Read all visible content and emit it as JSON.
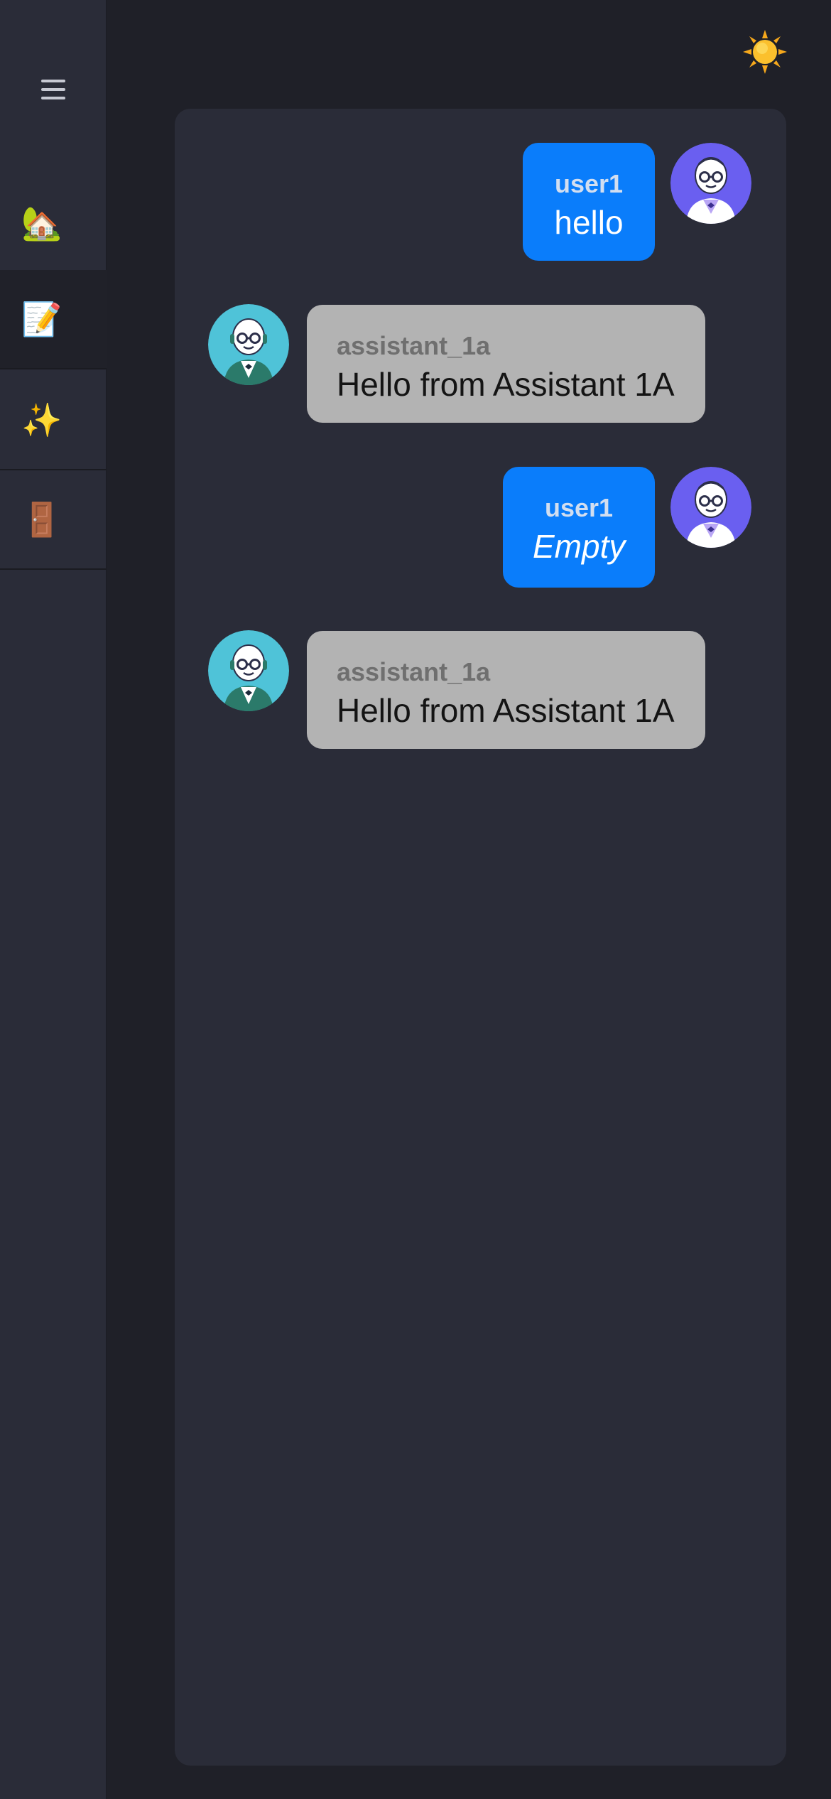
{
  "sidebar": {
    "menu_icon": "hamburger-menu-icon",
    "items": [
      {
        "name": "home",
        "icon": "house-with-tree-icon",
        "glyph": "🏡",
        "active": false
      },
      {
        "name": "notes",
        "icon": "memo-pencil-icon",
        "glyph": "📝",
        "active": true
      },
      {
        "name": "sparkles",
        "icon": "sparkles-icon",
        "glyph": "✨",
        "active": false
      },
      {
        "name": "logout",
        "icon": "door-icon",
        "glyph": "🚪",
        "active": false
      }
    ]
  },
  "header": {
    "theme_toggle_icon": "sun-icon"
  },
  "colors": {
    "background": "#1f2028",
    "panel": "#2a2c38",
    "user_bubble": "#0a7dfb",
    "assistant_bubble": "#b3b3b3",
    "user_avatar": "#6a5ff0",
    "assistant_avatar": "#4fc3d8"
  },
  "messages": [
    {
      "role": "user",
      "sender": "user1",
      "text": "hello",
      "italic": false
    },
    {
      "role": "assistant",
      "sender": "assistant_1a",
      "text": "Hello from Assistant 1A",
      "italic": false
    },
    {
      "role": "user",
      "sender": "user1",
      "text": "Empty",
      "italic": true
    },
    {
      "role": "assistant",
      "sender": "assistant_1a",
      "text": "Hello from Assistant 1A",
      "italic": false
    }
  ]
}
